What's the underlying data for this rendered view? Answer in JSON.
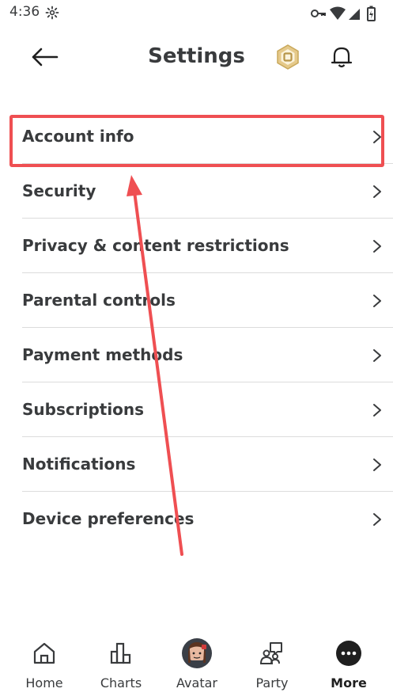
{
  "status": {
    "time": "4:36"
  },
  "header": {
    "title": "Settings"
  },
  "settings": {
    "items": [
      {
        "label": "Account info"
      },
      {
        "label": "Security"
      },
      {
        "label": "Privacy & content restrictions"
      },
      {
        "label": "Parental controls"
      },
      {
        "label": "Payment methods"
      },
      {
        "label": "Subscriptions"
      },
      {
        "label": "Notifications"
      },
      {
        "label": "Device preferences"
      }
    ]
  },
  "nav": {
    "items": [
      {
        "label": "Home",
        "icon": "home-icon"
      },
      {
        "label": "Charts",
        "icon": "charts-icon"
      },
      {
        "label": "Avatar",
        "icon": "avatar-icon"
      },
      {
        "label": "Party",
        "icon": "party-icon"
      },
      {
        "label": "More",
        "icon": "more-icon",
        "active": true
      }
    ]
  },
  "colors": {
    "highlight": "#ef4f52",
    "text": "#393b3d",
    "robux_gold": "#c9a85a"
  }
}
